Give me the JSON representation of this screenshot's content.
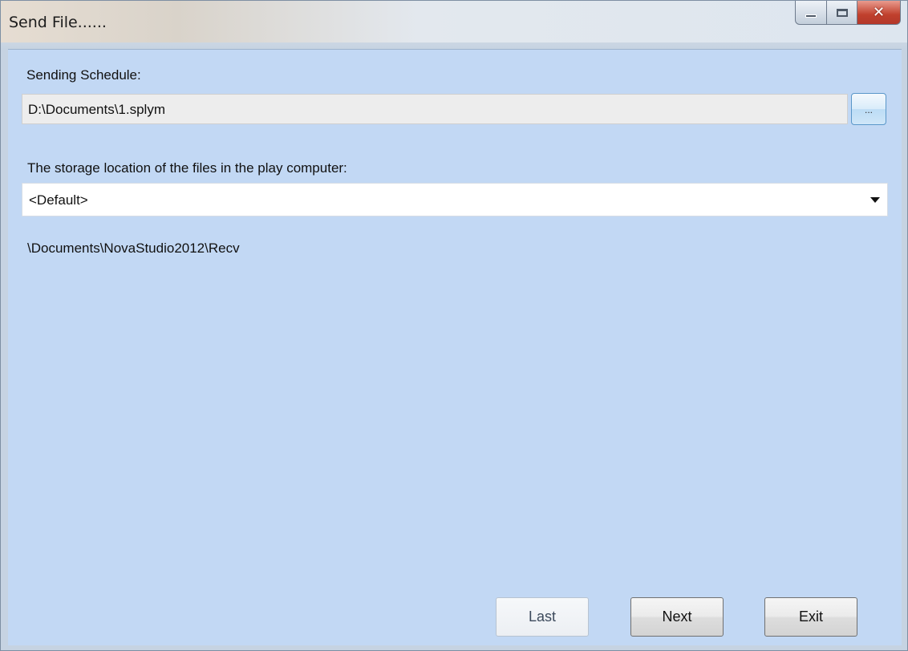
{
  "window": {
    "title": "Send File......",
    "controls": {
      "minimize": "minimize-icon",
      "maximize": "maximize-icon",
      "close": "close-icon"
    }
  },
  "form": {
    "schedule_label": "Sending Schedule:",
    "schedule_path": "D:\\Documents\\1.splym",
    "browse_label": "...",
    "storage_label": "The storage location of the files in the play computer:",
    "storage_selected": "<Default>",
    "storage_path": "\\Documents\\NovaStudio2012\\Recv"
  },
  "buttons": {
    "last": "Last",
    "next": "Next",
    "exit": "Exit"
  },
  "colors": {
    "client_bg": "#c2d8f4",
    "close_button": "#c0402d"
  }
}
